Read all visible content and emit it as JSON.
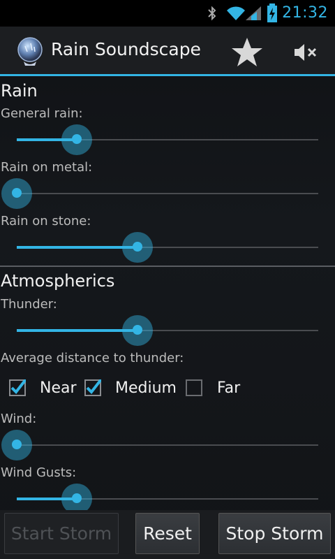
{
  "status_bar": {
    "time": "21:32",
    "icons": [
      "bluetooth-icon",
      "wifi-icon",
      "signal-icon",
      "battery-charging-icon"
    ]
  },
  "action_bar": {
    "title": "Rain Soundscape",
    "icons": [
      "app-logo-icon",
      "star-icon",
      "mute-icon"
    ]
  },
  "rain": {
    "title": "Rain",
    "general_rain": {
      "label": "General rain:",
      "value": 20
    },
    "rain_on_metal": {
      "label": "Rain on metal:",
      "value": 0
    },
    "rain_on_stone": {
      "label": "Rain on stone:",
      "value": 40
    }
  },
  "atmospherics": {
    "title": "Atmospherics",
    "thunder": {
      "label": "Thunder:",
      "value": 40
    },
    "distance": {
      "label": "Average distance to thunder:",
      "options": [
        {
          "label": "Near",
          "checked": true
        },
        {
          "label": "Medium",
          "checked": true
        },
        {
          "label": "Far",
          "checked": false
        }
      ]
    },
    "wind": {
      "label": "Wind:",
      "value": 0
    },
    "wind_gusts": {
      "label": "Wind Gusts:",
      "value": 20
    }
  },
  "buttons": {
    "start": {
      "label": "Start Storm",
      "enabled": false
    },
    "reset": {
      "label": "Reset",
      "enabled": true
    },
    "stop": {
      "label": "Stop Storm",
      "enabled": true
    }
  },
  "colors": {
    "accent": "#33b5e5"
  }
}
